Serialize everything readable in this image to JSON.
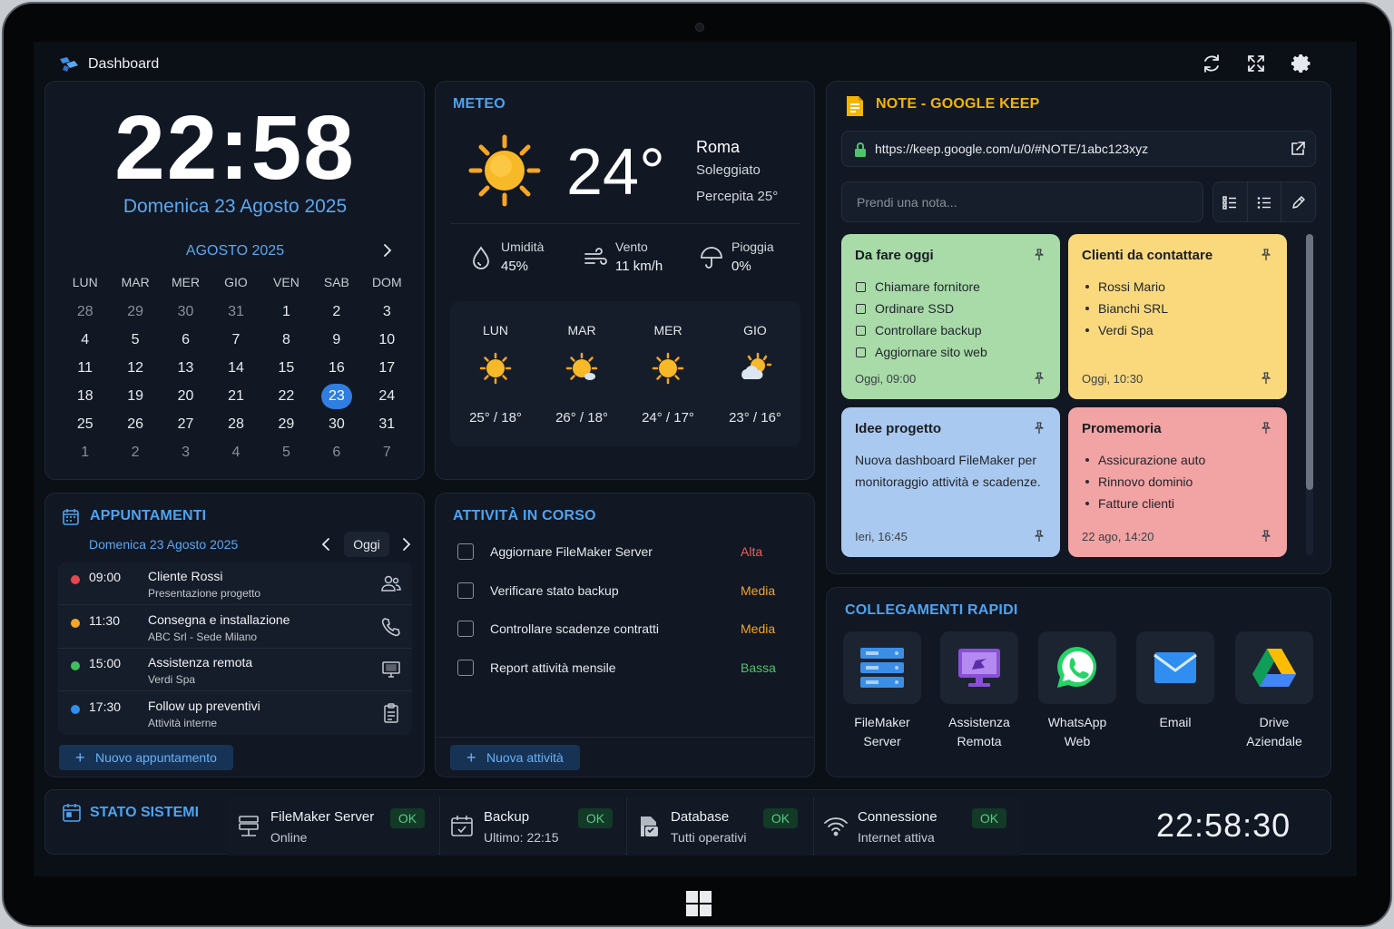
{
  "app": {
    "title": "Dashboard"
  },
  "clock": {
    "time": "22:58",
    "date": "Domenica 23 Agosto 2025"
  },
  "calendar": {
    "month": "AGOSTO 2025",
    "weekdays": [
      "LUN",
      "MAR",
      "MER",
      "GIO",
      "VEN",
      "SAB",
      "DOM"
    ],
    "days": [
      {
        "n": "28",
        "other": true
      },
      {
        "n": "29",
        "other": true
      },
      {
        "n": "30",
        "other": true
      },
      {
        "n": "31",
        "other": true
      },
      {
        "n": "1"
      },
      {
        "n": "2"
      },
      {
        "n": "3"
      },
      {
        "n": "4"
      },
      {
        "n": "5"
      },
      {
        "n": "6"
      },
      {
        "n": "7"
      },
      {
        "n": "8"
      },
      {
        "n": "9"
      },
      {
        "n": "10"
      },
      {
        "n": "11"
      },
      {
        "n": "12"
      },
      {
        "n": "13"
      },
      {
        "n": "14"
      },
      {
        "n": "15"
      },
      {
        "n": "16"
      },
      {
        "n": "17"
      },
      {
        "n": "18"
      },
      {
        "n": "19"
      },
      {
        "n": "20"
      },
      {
        "n": "21"
      },
      {
        "n": "22"
      },
      {
        "n": "23",
        "today": true
      },
      {
        "n": "24"
      },
      {
        "n": "25"
      },
      {
        "n": "26"
      },
      {
        "n": "27"
      },
      {
        "n": "28"
      },
      {
        "n": "29"
      },
      {
        "n": "30"
      },
      {
        "n": "31"
      },
      {
        "n": "1",
        "other": true
      },
      {
        "n": "2",
        "other": true
      },
      {
        "n": "3",
        "other": true
      },
      {
        "n": "4",
        "other": true
      },
      {
        "n": "5",
        "other": true
      },
      {
        "n": "6",
        "other": true
      },
      {
        "n": "7",
        "other": true
      }
    ]
  },
  "weather": {
    "title": "METEO",
    "temp": "24°",
    "city": "Roma",
    "condition": "Soleggiato",
    "feels": "Percepita 25°",
    "stats": [
      {
        "label": "Umidità",
        "value": "45%",
        "icon": "droplet-icon"
      },
      {
        "label": "Vento",
        "value": "11 km/h",
        "icon": "wind-icon"
      },
      {
        "label": "Pioggia",
        "value": "0%",
        "icon": "umbrella-icon"
      }
    ],
    "forecast": [
      {
        "day": "LUN",
        "temp": "25° / 18°",
        "icon": "sun-icon"
      },
      {
        "day": "MAR",
        "temp": "26° / 18°",
        "icon": "sun-cloud-icon"
      },
      {
        "day": "MER",
        "temp": "24° / 17°",
        "icon": "sun-icon"
      },
      {
        "day": "GIO",
        "temp": "23° / 16°",
        "icon": "partly-cloudy-icon"
      }
    ]
  },
  "notes": {
    "title": "NOTE - GOOGLE KEEP",
    "url": "https://keep.google.com/u/0/#NOTE/1abc123xyz",
    "placeholder": "Prendi una nota...",
    "cards": [
      {
        "title": "Da fare oggi",
        "type": "check",
        "items": [
          "Chiamare fornitore",
          "Ordinare SSD",
          "Controllare backup",
          "Aggiornare sito web"
        ],
        "timestamp": "Oggi, 09:00",
        "color": "#a8dba8"
      },
      {
        "title": "Clienti da contattare",
        "type": "bullet",
        "items": [
          "Rossi Mario",
          "Bianchi SRL",
          "Verdi Spa"
        ],
        "timestamp": "Oggi, 10:30",
        "color": "#f9d97c"
      },
      {
        "title": "Idee progetto",
        "type": "text",
        "body": "Nuova dashboard FileMaker per monitoraggio attività e scadenze.",
        "timestamp": "Ieri, 16:45",
        "color": "#a9c9f0"
      },
      {
        "title": "Promemoria",
        "type": "bullet",
        "items": [
          "Assicurazione auto",
          "Rinnovo dominio",
          "Fatture clienti"
        ],
        "timestamp": "22 ago, 14:20",
        "color": "#f2a3a3"
      }
    ]
  },
  "appointments": {
    "title": "APPUNTAMENTI",
    "date": "Domenica 23 Agosto 2025",
    "today_label": "Oggi",
    "items": [
      {
        "time": "09:00",
        "title": "Cliente Rossi",
        "sub": "Presentazione progetto",
        "color": "#e5484d",
        "icon": "users-icon"
      },
      {
        "time": "11:30",
        "title": "Consegna e installazione",
        "sub": "ABC Srl - Sede Milano",
        "color": "#f5a524",
        "icon": "phone-icon"
      },
      {
        "time": "15:00",
        "title": "Assistenza remota",
        "sub": "Verdi Spa",
        "color": "#3fbf5f",
        "icon": "monitor-icon"
      },
      {
        "time": "17:30",
        "title": "Follow up preventivi",
        "sub": "Attività interne",
        "color": "#2f8ef0",
        "icon": "clipboard-icon"
      }
    ],
    "new_label": "Nuovo appuntamento"
  },
  "tasks": {
    "title": "ATTIVITÀ IN CORSO",
    "items": [
      {
        "label": "Aggiornare FileMaker Server",
        "priority": "Alta",
        "color": "#f0605a"
      },
      {
        "label": "Verificare stato backup",
        "priority": "Media",
        "color": "#f5a524"
      },
      {
        "label": "Controllare scadenze contratti",
        "priority": "Media",
        "color": "#f5a524"
      },
      {
        "label": "Report attività mensile",
        "priority": "Bassa",
        "color": "#4cc46e"
      }
    ],
    "new_label": "Nuova attività"
  },
  "quick_links": {
    "title": "COLLEGAMENTI RAPIDI",
    "items": [
      {
        "line1": "FileMaker",
        "line2": "Server",
        "icon": "server-icon"
      },
      {
        "line1": "Assistenza",
        "line2": "Remota",
        "icon": "remote-desktop-icon"
      },
      {
        "line1": "WhatsApp",
        "line2": "Web",
        "icon": "whatsapp-icon"
      },
      {
        "line1": "Email",
        "line2": "",
        "icon": "email-icon"
      },
      {
        "line1": "Drive",
        "line2": "Aziendale",
        "icon": "drive-icon"
      }
    ]
  },
  "status": {
    "title": "STATO SISTEMI",
    "items": [
      {
        "name": "FileMaker Server",
        "desc": "Online",
        "badge": "OK",
        "icon": "server-network-icon"
      },
      {
        "name": "Backup",
        "desc": "Ultimo: 22:15",
        "badge": "OK",
        "icon": "backup-icon"
      },
      {
        "name": "Database",
        "desc": "Tutti operativi",
        "badge": "OK",
        "icon": "database-file-icon"
      },
      {
        "name": "Connessione",
        "desc": "Internet attiva",
        "badge": "OK",
        "icon": "wifi-icon"
      }
    ],
    "clock": "22:58:30"
  }
}
